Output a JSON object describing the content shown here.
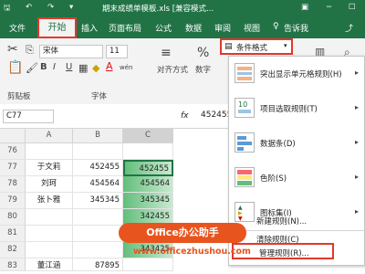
{
  "title_bar": {
    "title": "期末成绩单模板.xls [兼容模式..."
  },
  "tabs": {
    "file": "文件",
    "home": "开始",
    "insert": "插入",
    "page_layout": "页面布局",
    "formulas": "公式",
    "data": "数据",
    "review": "审阅",
    "view": "视图",
    "tell_me": "告诉我"
  },
  "ribbon": {
    "font_name": "宋体",
    "font_size": "11",
    "bold": "B",
    "italic": "I",
    "underline": "U",
    "font_color_glyph": "A",
    "wen": "wén",
    "clipboard_label": "剪贴板",
    "font_label": "字体",
    "alignment_label": "对齐方式",
    "number_label": "数字",
    "number_format_glyph": "%",
    "cond_format_label": "条件格式"
  },
  "formula_bar": {
    "name_box": "C77",
    "fx": "fx",
    "value": "452455"
  },
  "grid": {
    "columns": [
      "A",
      "B",
      "C"
    ],
    "rows": [
      {
        "num": "76",
        "a": "",
        "b": "",
        "c": ""
      },
      {
        "num": "77",
        "a": "于文莉",
        "b": "452455",
        "c": "452455"
      },
      {
        "num": "78",
        "a": "刘珂",
        "b": "454564",
        "c": "454564"
      },
      {
        "num": "79",
        "a": "张卜雅",
        "b": "345345",
        "c": "345345"
      },
      {
        "num": "80",
        "a": "",
        "b": "",
        "c": "342455"
      },
      {
        "num": "81",
        "a": "",
        "b": "",
        "c": "342454"
      },
      {
        "num": "82",
        "a": "",
        "b": "",
        "c": "343425"
      },
      {
        "num": "83",
        "a": "董江涵",
        "b": "87895",
        "c": ""
      }
    ]
  },
  "menu": {
    "items": [
      {
        "label": "突出显示单元格规则(H)"
      },
      {
        "label": "项目选取规则(T)"
      },
      {
        "label": "数据条(D)"
      },
      {
        "label": "色阶(S)"
      },
      {
        "label": "图标集(I)"
      }
    ],
    "new_rule": "新建规则(N)...",
    "clear_rules": "清除规则(C)",
    "manage_rules": "管理规则(R)..."
  },
  "watermark": {
    "title": "Office办公助手",
    "url": "www.officezhushou.com"
  },
  "colors": {
    "brand": "#217346",
    "highlight": "#e0392b",
    "scale_dark": "#63be7b",
    "scale_light": "#c9e9d1"
  }
}
